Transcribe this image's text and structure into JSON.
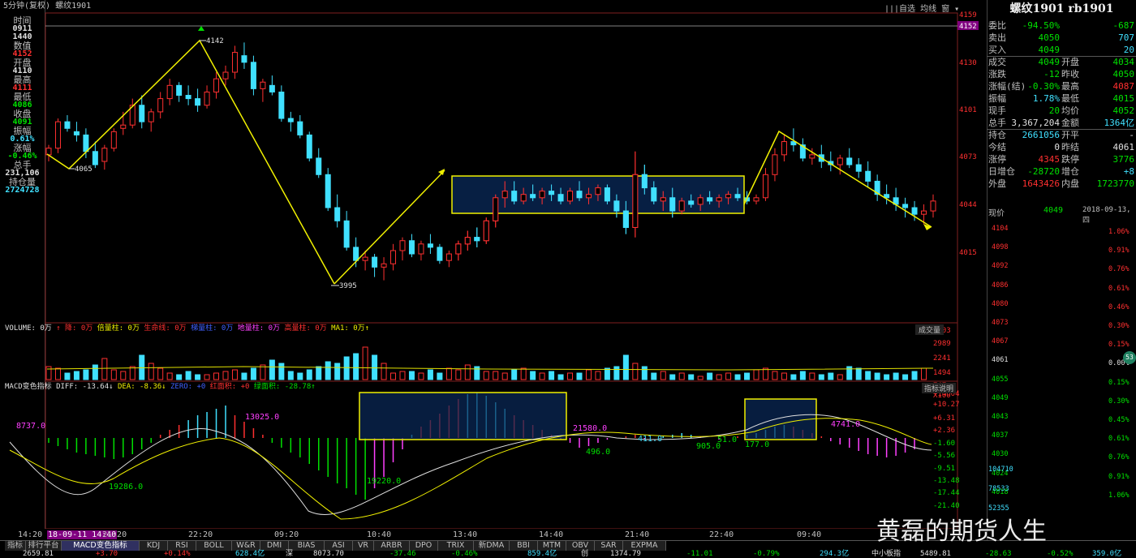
{
  "window": {
    "title": "5分钟(复权)  螺纹1901"
  },
  "toolbar": {
    "items": [
      "|||自选",
      "均线",
      "窗",
      "▾"
    ]
  },
  "left_panel": {
    "rows": [
      {
        "label": "时间",
        "value": "0911",
        "color": "white"
      },
      {
        "label": "",
        "value": "1440",
        "color": "white"
      },
      {
        "label": "数值",
        "value": "4152",
        "color": "red"
      },
      {
        "label": "开盘",
        "value": "4110",
        "color": "white"
      },
      {
        "label": "最高",
        "value": "4111",
        "color": "red"
      },
      {
        "label": "最低",
        "value": "4086",
        "color": "green"
      },
      {
        "label": "收盘",
        "value": "4091",
        "color": "green"
      },
      {
        "label": "振幅",
        "value": "0.61%",
        "color": "cyan"
      },
      {
        "label": "涨幅",
        "value": "-0.46%",
        "color": "green"
      },
      {
        "label": "总手",
        "value": "231,106",
        "color": "white"
      },
      {
        "label": "持仓量",
        "value": "2724728",
        "color": "cyan"
      }
    ]
  },
  "main_chart": {
    "price_axis": [
      "4159",
      "4152",
      "4130",
      "4101",
      "4073",
      "4044",
      "4015"
    ],
    "annotations": {
      "high": "4142",
      "low1": "4065",
      "low2": "3995"
    },
    "time_axis": [
      "14:20",
      "18-09-11 14:40",
      "21:20",
      "22:20",
      "09:20",
      "10:40",
      "13:40",
      "14:40",
      "21:40",
      "22:40",
      "09:40"
    ]
  },
  "volume_panel": {
    "label_parts": [
      "VOLUME: 0万",
      "↑ 降: 0万",
      "倍量柱: 0万",
      "生命线: 0万",
      "梯量柱: 0万",
      "地量柱: 0万",
      "高量柱: 0万",
      "MA1: 0万↑"
    ],
    "dropdown": "成交量",
    "axis": [
      "3703",
      "2989",
      "2241",
      "1494",
      "747",
      "X100"
    ]
  },
  "macd_panel": {
    "label_parts": [
      "MACD变色指标 DIFF: -13.64↓",
      "DEA: -8.36↓",
      "ZERO: +0",
      "红面积: +0",
      "绿面积: -28.78↑"
    ],
    "button": "指标说明",
    "axis": [
      "+14.04",
      "+10.27",
      "+6.31",
      "+2.36",
      "-1.60",
      "-5.56",
      "-9.51",
      "-13.48",
      "-17.44",
      "-21.40"
    ],
    "area_labels": [
      "8737.0",
      "13025.0",
      "19286.0",
      "19220.0",
      "21580.0",
      "496.0",
      "411.0",
      "905.0",
      "51.0",
      "177.0",
      "4741.0"
    ]
  },
  "quote": {
    "title": "螺纹1901  rb1901",
    "rows": [
      {
        "l": "委比",
        "v": "-94.50%",
        "vc": "green",
        "r": "",
        "rv": "-687",
        "rc": "green"
      },
      {
        "l": "卖出",
        "v": "4050",
        "vc": "green",
        "r": "",
        "rv": "707",
        "rc": "cyan"
      },
      {
        "l": "买入",
        "v": "4049",
        "vc": "green",
        "r": "",
        "rv": "20",
        "rc": "cyan"
      },
      {
        "l": "成交",
        "v": "4049",
        "vc": "green",
        "r": "开盘",
        "rv": "4034",
        "rc": "green"
      },
      {
        "l": "涨跌",
        "v": "-12",
        "vc": "green",
        "r": "昨收",
        "rv": "4050",
        "rc": "green"
      },
      {
        "l": "涨幅(结)",
        "v": "-0.30%",
        "vc": "green",
        "r": "最高",
        "rv": "4087",
        "rc": "red"
      },
      {
        "l": "振幅",
        "v": "1.78%",
        "vc": "cyan",
        "r": "最低",
        "rv": "4015",
        "rc": "green"
      },
      {
        "l": "现手",
        "v": "20",
        "vc": "green",
        "r": "均价",
        "rv": "4052",
        "rc": "green"
      },
      {
        "l": "总手",
        "v": "3,367,204",
        "vc": "white",
        "r": "金额",
        "rv": "1364亿",
        "rc": "cyan"
      },
      {
        "l": "持仓",
        "v": "2661056",
        "vc": "cyan",
        "r": "开平",
        "rv": "-",
        "rc": "white"
      },
      {
        "l": "今结",
        "v": "0",
        "vc": "white",
        "r": "昨结",
        "rv": "4061",
        "rc": "white"
      },
      {
        "l": "涨停",
        "v": "4345",
        "vc": "red",
        "r": "跌停",
        "rv": "3776",
        "rc": "green"
      },
      {
        "l": "日增仓",
        "v": "-28720",
        "vc": "green",
        "r": "增仓",
        "rv": "+8",
        "rc": "cyan"
      },
      {
        "l": "外盘",
        "v": "1643426",
        "vc": "red",
        "r": "内盘",
        "rv": "1723770",
        "rc": "green"
      }
    ],
    "now_label": "现价",
    "now_price": "4049",
    "date": "2018-09-13,四",
    "mini_price_axis": [
      "4104",
      "4098",
      "4092",
      "4086",
      "4080",
      "4073",
      "4067",
      "4061",
      "4055",
      "4049",
      "4043",
      "4037",
      "4030",
      "4024",
      "4018"
    ],
    "mini_pct_axis": [
      "1.06%",
      "0.91%",
      "0.76%",
      "0.61%",
      "0.46%",
      "0.30%",
      "0.15%",
      "0.00%",
      "0.15%",
      "0.30%",
      "0.45%",
      "0.61%",
      "0.76%",
      "0.91%",
      "1.06%"
    ],
    "mini_vol_axis": [
      "104710",
      "78533",
      "52355"
    ],
    "badge": "53"
  },
  "tabs": [
    "指标",
    "排行平台",
    "MACD变色指标",
    "KDJ",
    "RSI",
    "BOLL",
    "W&R",
    "DMI",
    "BIAS",
    "ASI",
    "VR",
    "ARBR",
    "DPO",
    "TRIX",
    "新DMA",
    "BBI",
    "MTM",
    "OBV",
    "SAR",
    "EXPMA"
  ],
  "status": [
    "2659.81",
    "+3.70",
    "+0.14%",
    "628.4亿",
    "深",
    "8073.70",
    "-37.46",
    "-0.46%",
    "859.4亿",
    "创",
    "1374.79",
    "-11.01",
    "-0.79%",
    "294.3亿",
    "中小板指",
    "5489.81",
    "-28.63",
    "-0.52%",
    "359.0亿"
  ],
  "watermark": "黄磊的期货人生",
  "colors": {
    "up": "#ff3030",
    "down": "#40e0ff",
    "annot": "#ffff00",
    "volume_box": "#0a2a5a"
  }
}
